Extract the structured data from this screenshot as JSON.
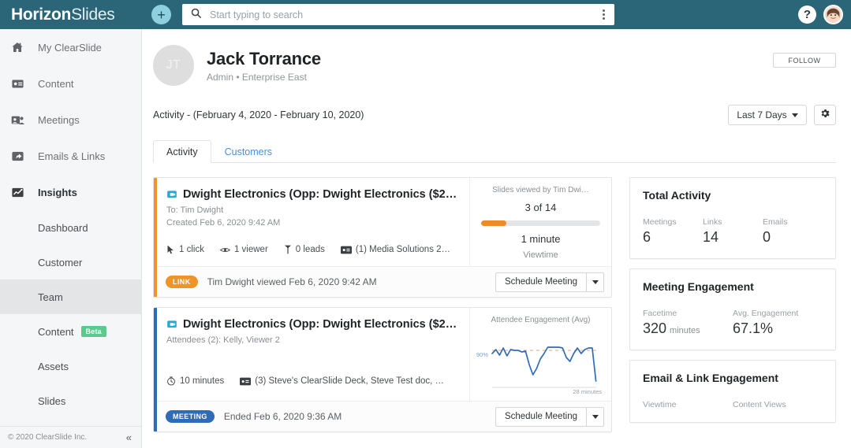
{
  "app": {
    "brand_bold": "Horizon",
    "brand_light": "Slides",
    "add_label": "+",
    "help_label": "?"
  },
  "search": {
    "placeholder": "Start typing to search",
    "value": "",
    "icon": "search-icon",
    "menu_icon": "kebab-menu-icon"
  },
  "sidebar": {
    "items": [
      {
        "label": "My ClearSlide",
        "icon": "home-icon",
        "active": false
      },
      {
        "label": "Content",
        "icon": "content-card-icon",
        "active": false
      },
      {
        "label": "Meetings",
        "icon": "meetings-icon",
        "active": false
      },
      {
        "label": "Emails & Links",
        "icon": "share-icon",
        "active": false
      },
      {
        "label": "Insights",
        "icon": "insights-chart-icon",
        "active": true
      }
    ],
    "subitems": [
      {
        "label": "Dashboard",
        "selected": false,
        "badge": ""
      },
      {
        "label": "Customer",
        "selected": false,
        "badge": ""
      },
      {
        "label": "Team",
        "selected": true,
        "badge": ""
      },
      {
        "label": "Content",
        "selected": false,
        "badge": "Beta"
      },
      {
        "label": "Assets",
        "selected": false,
        "badge": ""
      },
      {
        "label": "Slides",
        "selected": false,
        "badge": ""
      }
    ],
    "footer_text": "© 2020 ClearSlide Inc.",
    "collapse_icon": "«"
  },
  "profile": {
    "initials": "JT",
    "name": "Jack Torrance",
    "role": "Admin • Enterprise East",
    "follow_label": "FOLLOW"
  },
  "activity_header": {
    "title": "Activity - (February 4, 2020 - February 10, 2020)",
    "range_label": "Last 7 Days",
    "gear_icon": "gear-icon"
  },
  "tabs": [
    {
      "label": "Activity",
      "active": true
    },
    {
      "label": "Customers",
      "active": false
    }
  ],
  "cards": [
    {
      "accent_color": "#f0942a",
      "icon": "presentation-icon",
      "title": "Dwight Electronics (Opp: Dwight Electronics ($2…",
      "sub1": "To: Tim Dwight",
      "sub2": "Created Feb 6, 2020 9:42 AM",
      "meta": [
        {
          "icon": "cursor-click-icon",
          "text": "1 click"
        },
        {
          "icon": "eye-icon",
          "text": "1 viewer"
        },
        {
          "icon": "lead-icon",
          "text": "0 leads"
        },
        {
          "icon": "deck-icon",
          "text": "(1) Media Solutions 2…"
        }
      ],
      "right": {
        "type": "progress",
        "label": "Slides viewed by Tim Dwi…",
        "value": "3 of 14",
        "progress_pct": 21,
        "big": "1 minute",
        "small": "Viewtime"
      },
      "footer": {
        "badge": "LINK",
        "badge_type": "link",
        "text": "Tim Dwight viewed Feb 6, 2020 9:42 AM",
        "button": "Schedule Meeting"
      }
    },
    {
      "accent_color": "#2f6cb5",
      "icon": "presentation-icon",
      "title": "Dwight Electronics (Opp: Dwight Electronics ($2…",
      "sub1": "Attendees (2): Kelly, Viewer 2",
      "sub2": "",
      "meta": [
        {
          "icon": "clock-icon",
          "text": "10 minutes"
        },
        {
          "icon": "deck-icon",
          "text": "(3) Steve's ClearSlide Deck, Steve Test doc, …"
        }
      ],
      "right": {
        "type": "chart",
        "label": "Attendee Engagement (Avg)"
      },
      "footer": {
        "badge": "MEETING",
        "badge_type": "meeting",
        "text": "Ended Feb 6, 2020 9:36 AM",
        "button": "Schedule Meeting"
      }
    }
  ],
  "chart_data": {
    "type": "line",
    "title": "Attendee Engagement (Avg)",
    "xlabel": "28 minutes",
    "ylabel": "90%",
    "ytick_labels": [
      "90%"
    ],
    "xtick_labels": [
      "28 minutes"
    ],
    "ylim": [
      0,
      100
    ],
    "xlim": [
      0,
      28
    ],
    "grid": false,
    "legend": "none",
    "series": [
      {
        "name": "Attendee Engagement (Avg)",
        "color": "#2f6cb5",
        "x": [
          0,
          1,
          2,
          3,
          4,
          5,
          6,
          7,
          8,
          9,
          10,
          11,
          12,
          13,
          14,
          15,
          16,
          17,
          18,
          19,
          20,
          21,
          22,
          23,
          24,
          25,
          26,
          27,
          28
        ],
        "y": [
          88,
          93,
          86,
          95,
          85,
          93,
          92,
          92,
          90,
          91,
          73,
          60,
          68,
          80,
          88,
          96,
          96,
          96,
          96,
          95,
          84,
          79,
          88,
          95,
          88,
          92,
          94,
          94,
          52
        ]
      },
      {
        "name": "Average reference line",
        "color": "#e8a08a",
        "style": "dashed",
        "y_constant": 90
      }
    ]
  },
  "stats": [
    {
      "title": "Total Activity",
      "items": [
        {
          "key": "Meetings",
          "value": "6",
          "unit": ""
        },
        {
          "key": "Links",
          "value": "14",
          "unit": ""
        },
        {
          "key": "Emails",
          "value": "0",
          "unit": ""
        }
      ]
    },
    {
      "title": "Meeting Engagement",
      "items": [
        {
          "key": "Facetime",
          "value": "320",
          "unit": "minutes"
        },
        {
          "key": "Avg. Engagement",
          "value": "67.1%",
          "unit": ""
        }
      ]
    },
    {
      "title": "Email & Link Engagement",
      "items": [
        {
          "key": "Viewtime",
          "value": "",
          "unit": ""
        },
        {
          "key": "Content Views",
          "value": "",
          "unit": ""
        }
      ]
    }
  ]
}
